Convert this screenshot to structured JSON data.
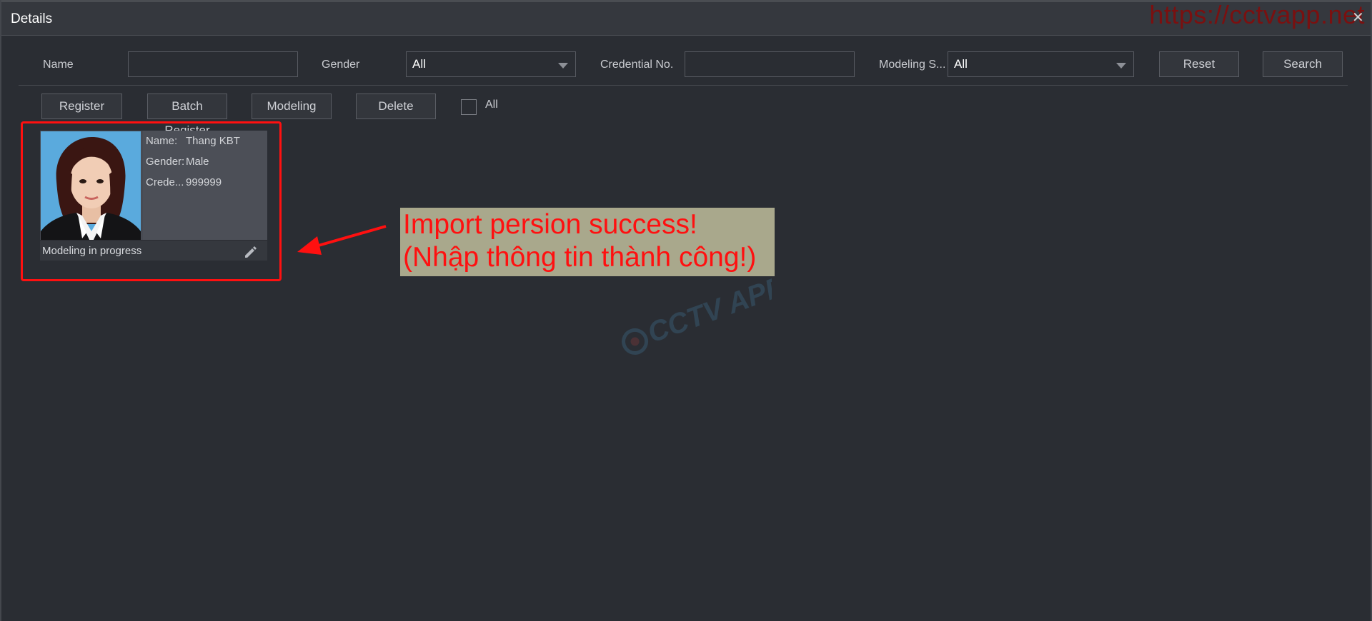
{
  "window": {
    "title": "Details",
    "watermark_url": "https://cctvapp.net",
    "close_symbol": "✕"
  },
  "filters": {
    "name_label": "Name",
    "name_value": "",
    "gender_label": "Gender",
    "gender_value": "All",
    "credential_label": "Credential No.",
    "credential_value": "",
    "modeling_label": "Modeling S...",
    "modeling_value": "All",
    "reset_label": "Reset",
    "search_label": "Search"
  },
  "actions": {
    "register_label": "Register",
    "batch_register_label": "Batch Register",
    "modeling_label": "Modeling",
    "delete_label": "Delete",
    "all_label": "All",
    "all_checked": false
  },
  "person": {
    "name_key": "Name:",
    "name_val": "Thang KBT",
    "gender_key": "Gender:",
    "gender_val": "Male",
    "credential_key": "Crede...",
    "credential_val": "999999",
    "status": "Modeling in progress"
  },
  "annotation": {
    "line1": "Import persion success!",
    "line2": "(Nhập thông tin thành công!)",
    "highlight_color": "#ff1010",
    "background_color": "#a9a88c"
  },
  "colors": {
    "window_bg": "#2a2d33",
    "titlebar_bg": "#35383e",
    "watermark_color": "#7a1010"
  }
}
